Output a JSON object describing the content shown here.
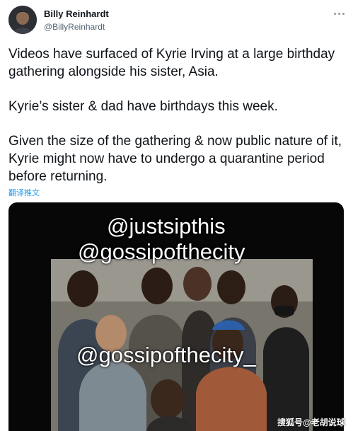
{
  "tweet": {
    "author_name": "Billy Reinhardt",
    "author_handle": "@BillyReinhardt",
    "more_icon": "more-options-icon",
    "paragraphs": [
      "Videos have surfaced of Kyrie Irving at a large birthday gathering alongside his sister, Asia.",
      "Kyrie’s sister & dad have birthdays this week.",
      "Given the size of the gathering & now public nature of it, Kyrie might now have to undergo a quarantine period before returning."
    ],
    "translate_label": "翻译推文"
  },
  "media": {
    "overlay_texts": [
      "@justsipthis",
      "@gossipofthecity",
      "@gossipofthecity_"
    ]
  },
  "watermark": "搜狐号@老胡说球",
  "colors": {
    "link": "#1d9bf0",
    "text": "#0f1419",
    "secondary": "#536471",
    "media_background": "#070707"
  }
}
